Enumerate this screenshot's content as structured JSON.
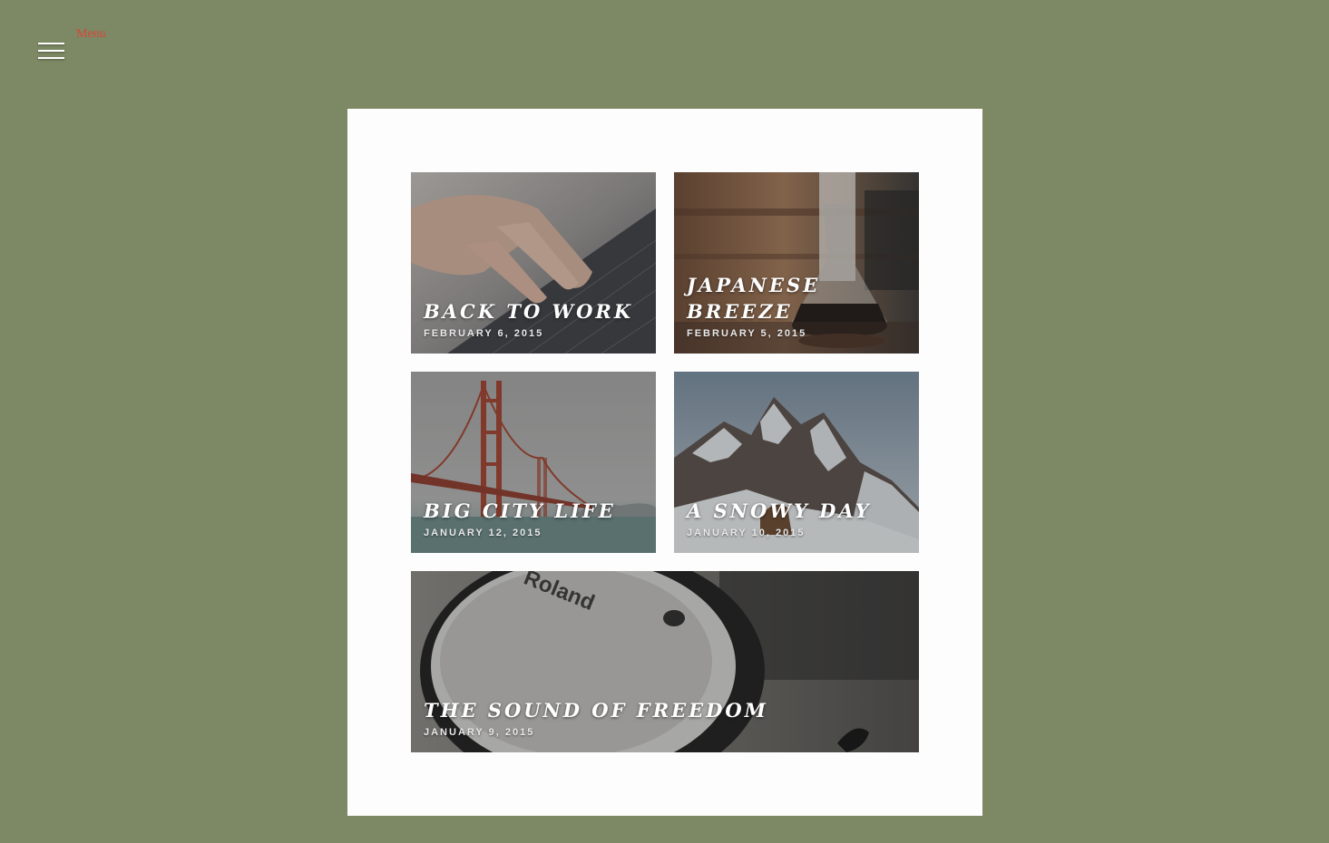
{
  "header": {
    "menu_label": "Menu"
  },
  "colors": {
    "background": "#7d8864",
    "panel": "#fdfdfd",
    "menu_label": "#d9473a"
  },
  "posts": [
    {
      "title": "Back to Work",
      "date": "February 6, 2015",
      "image": "hands-typing-laptop-keyboard"
    },
    {
      "title": "Japanese Breeze",
      "date": "February 5, 2015",
      "image": "glass-coffee-carafe"
    },
    {
      "title": "Big City Life",
      "date": "January 12, 2015",
      "image": "golden-gate-bridge-fog"
    },
    {
      "title": "A Snowy Day",
      "date": "January 10, 2015",
      "image": "snowy-mountain-peak"
    },
    {
      "title": "The Sound of Freedom",
      "date": "January 9, 2015",
      "image": "roland-drum-pad"
    }
  ]
}
